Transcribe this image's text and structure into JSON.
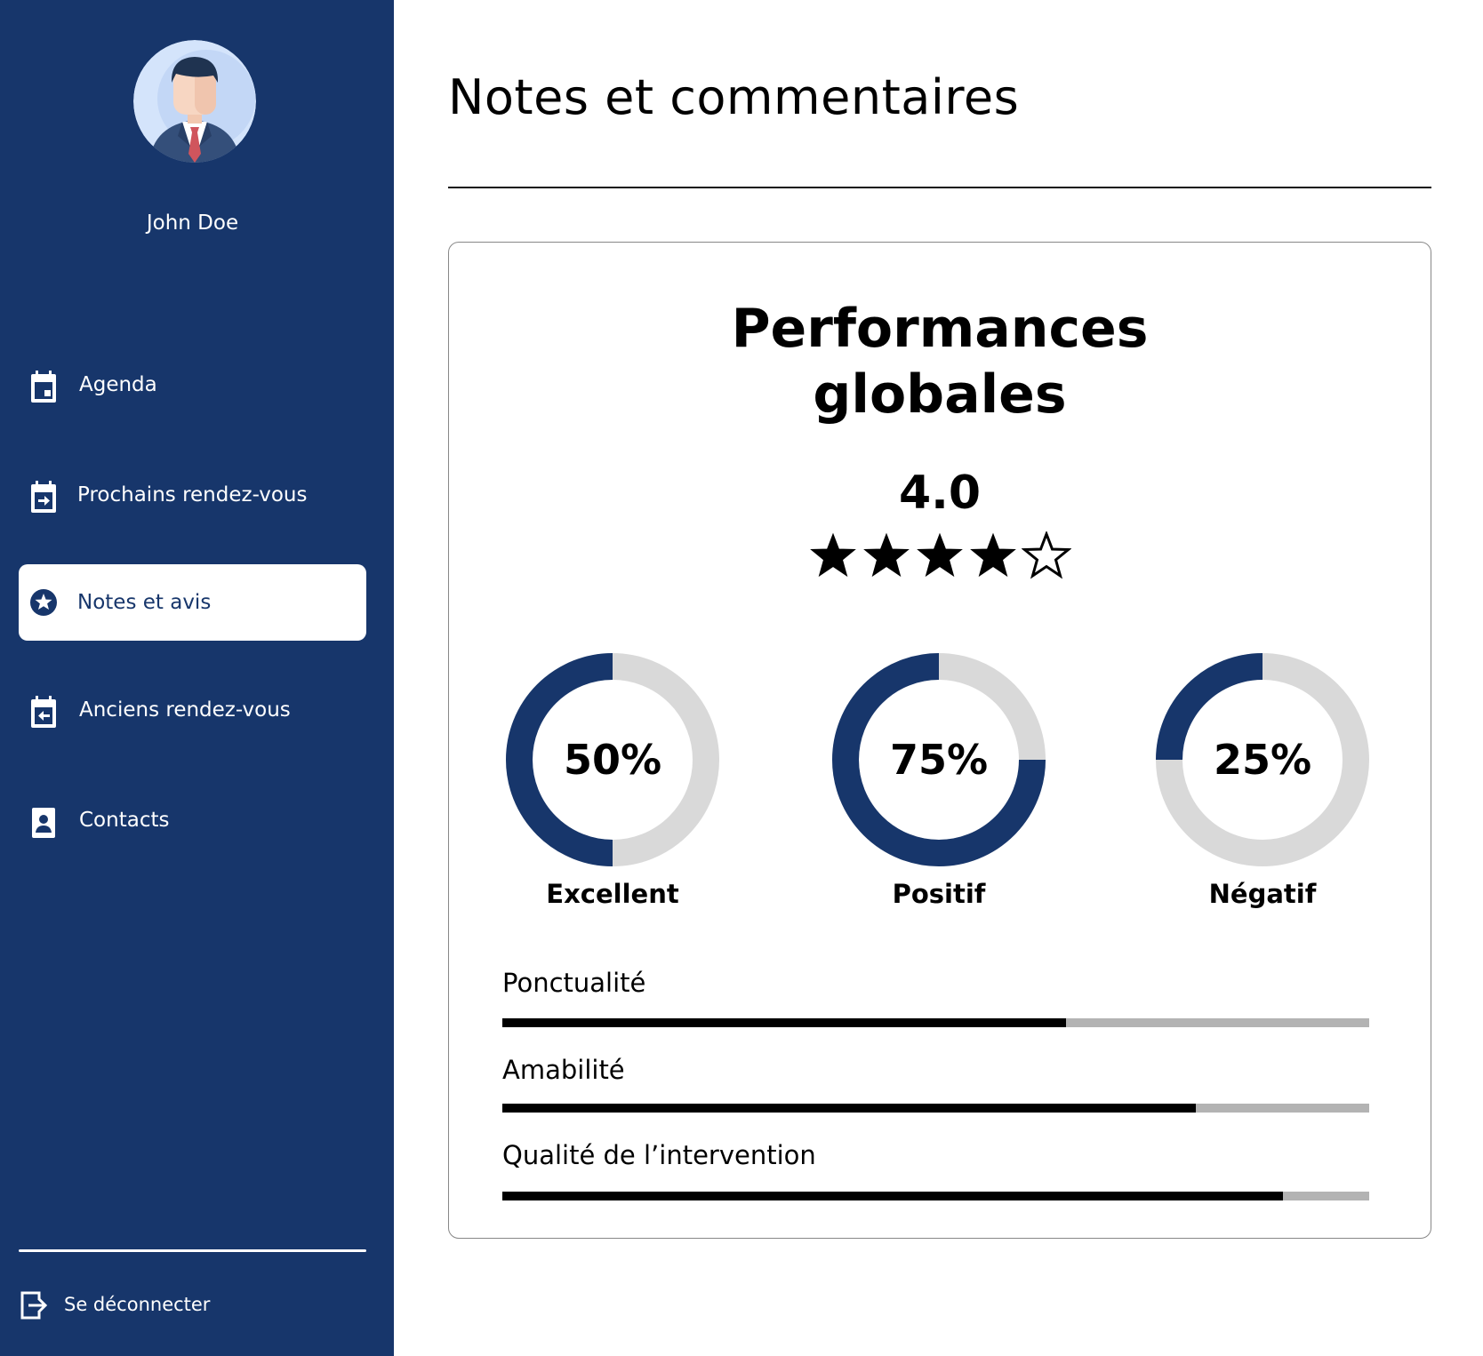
{
  "user": {
    "name": "John Doe"
  },
  "nav": {
    "items": [
      {
        "label": "Agenda",
        "icon": "calendar-icon",
        "active": false
      },
      {
        "label": "Prochains rendez-vous",
        "icon": "calendar-arrow-right-icon",
        "active": false
      },
      {
        "label": "Notes et avis",
        "icon": "star-badge-icon",
        "active": true
      },
      {
        "label": "Anciens rendez-vous",
        "icon": "calendar-arrow-left-icon",
        "active": false
      },
      {
        "label": "Contacts",
        "icon": "contact-card-icon",
        "active": false
      }
    ],
    "logout_label": "Se déconnecter",
    "logout_icon": "logout-icon"
  },
  "page": {
    "title": "Notes et commentaires"
  },
  "performance": {
    "title": "Performances globales",
    "rating": "4.0",
    "stars": {
      "filled": 4,
      "total": 5
    },
    "donuts": [
      {
        "value": "50%",
        "fraction": 0.5,
        "label": "Excellent"
      },
      {
        "value": "75%",
        "fraction": 0.75,
        "label": "Positif"
      },
      {
        "value": "25%",
        "fraction": 0.25,
        "label": "Négatif"
      }
    ],
    "bars": [
      {
        "label": "Ponctualité",
        "fraction": 0.65
      },
      {
        "label": "Amabilité",
        "fraction": 0.8
      },
      {
        "label": "Qualité de l’intervention",
        "fraction": 0.9
      }
    ]
  },
  "colors": {
    "sidebar": "#17366b",
    "accent": "#17366b",
    "track": "#d9d9d9",
    "bar_track": "#b3b3b3",
    "bar_fill": "#000000"
  }
}
